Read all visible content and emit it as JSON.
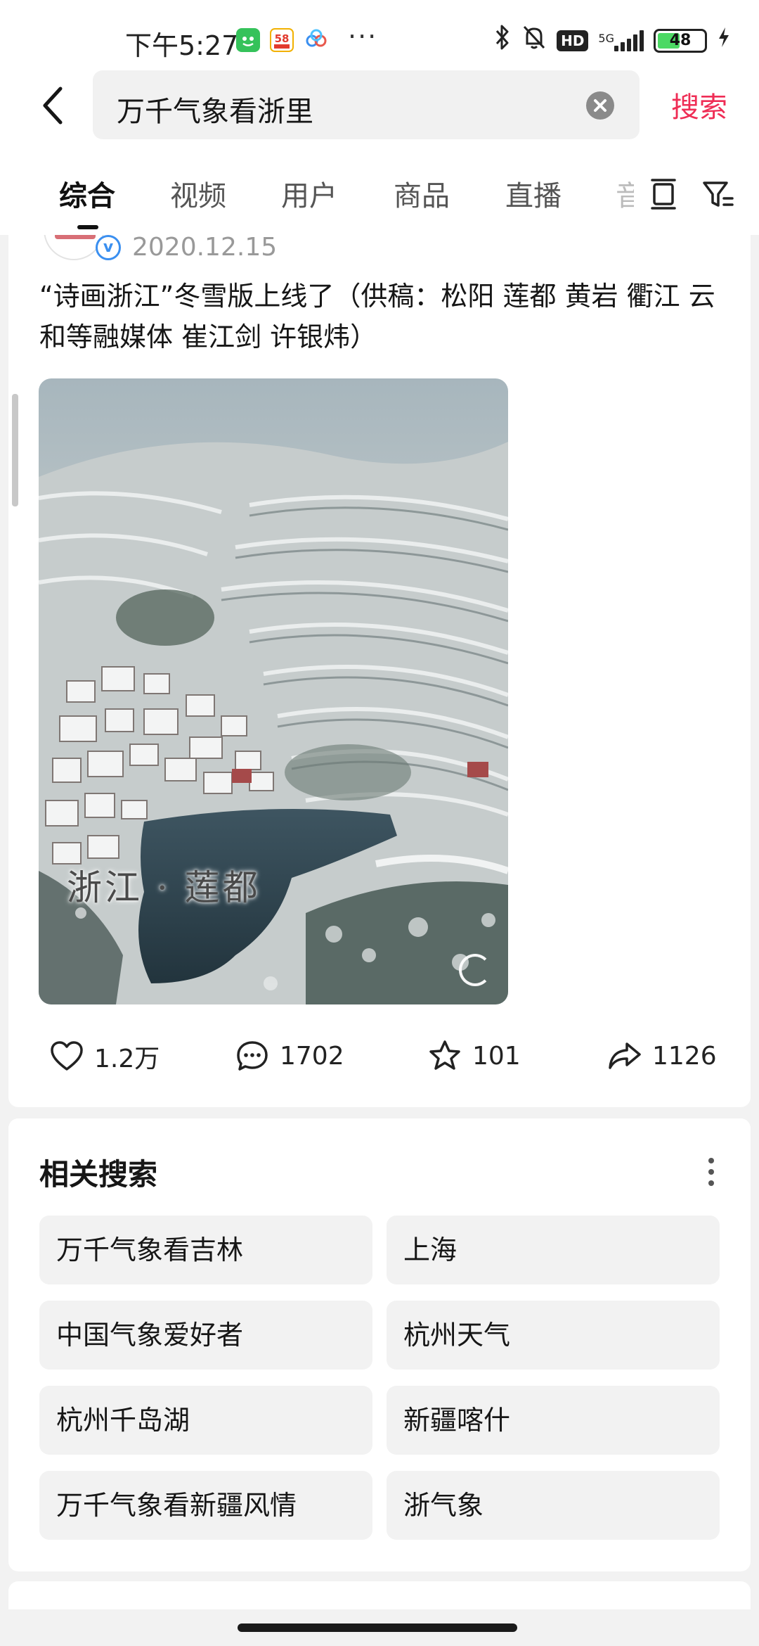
{
  "status_bar": {
    "time": "下午5:27",
    "more": "···",
    "hd": "HD",
    "network": "5G",
    "battery": "48",
    "battery_level_percent": 48
  },
  "search": {
    "query": "万千气象看浙里",
    "search_label": "搜索"
  },
  "tabs": [
    {
      "label": "综合",
      "active": true
    },
    {
      "label": "视频"
    },
    {
      "label": "用户"
    },
    {
      "label": "商品"
    },
    {
      "label": "直播"
    },
    {
      "label": "音"
    }
  ],
  "post": {
    "date": "2020.12.15",
    "verified_mark": "v",
    "title": "“诗画浙江”冬雪版上线了（供稿：松阳 莲都 黄岩  衢江 云和等融媒体 崔江剑 许银炜）",
    "video_caption": "浙江 · 莲都",
    "likes": "1.2万",
    "comments": "1702",
    "favorites": "101",
    "shares": "1126"
  },
  "related": {
    "title": "相关搜索",
    "items": [
      "万千气象看吉林",
      "上海",
      "中国气象爱好者",
      "杭州天气",
      "杭州千岛湖",
      "新疆喀什",
      "万千气象看新疆风情",
      "浙气象"
    ]
  },
  "colors": {
    "accent": "#ef2d55",
    "background": "#f2f2f2",
    "card": "#ffffff",
    "chip": "#f2f2f2"
  }
}
